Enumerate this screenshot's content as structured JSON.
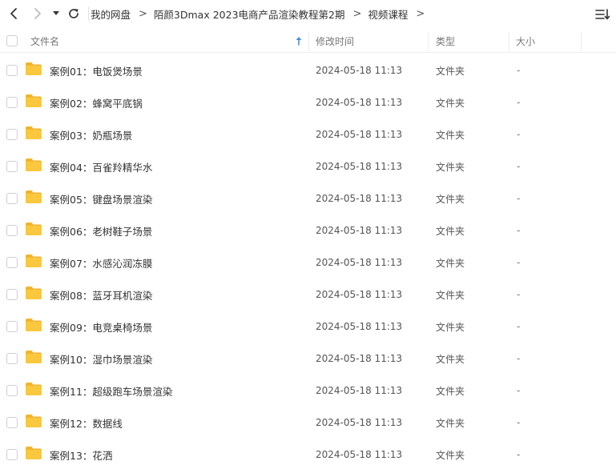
{
  "breadcrumb": {
    "items": [
      "我的网盘",
      "陌颜3Dmax 2023电商产品渲染教程第2期",
      "视频课程"
    ],
    "separator": ">"
  },
  "icons": {
    "back": "chevron-left-icon",
    "forward": "chevron-right-icon",
    "history": "caret-down-icon",
    "refresh": "refresh-icon",
    "sort": "sort-list-icon",
    "folder": "folder-icon"
  },
  "colors": {
    "folder": "#F9C83E",
    "folder_tab": "#F2B52C",
    "sort_arrow": "#4A90E2"
  },
  "columns": {
    "name": "文件名",
    "modified": "修改时间",
    "type": "类型",
    "size": "大小"
  },
  "files": [
    {
      "name": "案例01：电饭煲场景",
      "modified": "2024-05-18 11:13",
      "type": "文件夹",
      "size": "-"
    },
    {
      "name": "案例02：蜂窝平底锅",
      "modified": "2024-05-18 11:13",
      "type": "文件夹",
      "size": "-"
    },
    {
      "name": "案例03：奶瓶场景",
      "modified": "2024-05-18 11:13",
      "type": "文件夹",
      "size": "-"
    },
    {
      "name": "案例04：百雀羚精华水",
      "modified": "2024-05-18 11:13",
      "type": "文件夹",
      "size": "-"
    },
    {
      "name": "案例05：键盘场景渲染",
      "modified": "2024-05-18 11:13",
      "type": "文件夹",
      "size": "-"
    },
    {
      "name": "案例06：老树鞋子场景",
      "modified": "2024-05-18 11:13",
      "type": "文件夹",
      "size": "-"
    },
    {
      "name": "案例07：水感沁润冻膜",
      "modified": "2024-05-18 11:13",
      "type": "文件夹",
      "size": "-"
    },
    {
      "name": "案例08：蓝牙耳机渲染",
      "modified": "2024-05-18 11:13",
      "type": "文件夹",
      "size": "-"
    },
    {
      "name": "案例09：电竞桌椅场景",
      "modified": "2024-05-18 11:13",
      "type": "文件夹",
      "size": "-"
    },
    {
      "name": "案例10：湿巾场景渲染",
      "modified": "2024-05-18 11:13",
      "type": "文件夹",
      "size": "-"
    },
    {
      "name": "案例11：超级跑车场景渲染",
      "modified": "2024-05-18 11:13",
      "type": "文件夹",
      "size": "-"
    },
    {
      "name": "案例12：数据线",
      "modified": "2024-05-18 11:13",
      "type": "文件夹",
      "size": "-"
    },
    {
      "name": "案例13：花洒",
      "modified": "2024-05-18 11:13",
      "type": "文件夹",
      "size": "-"
    }
  ]
}
